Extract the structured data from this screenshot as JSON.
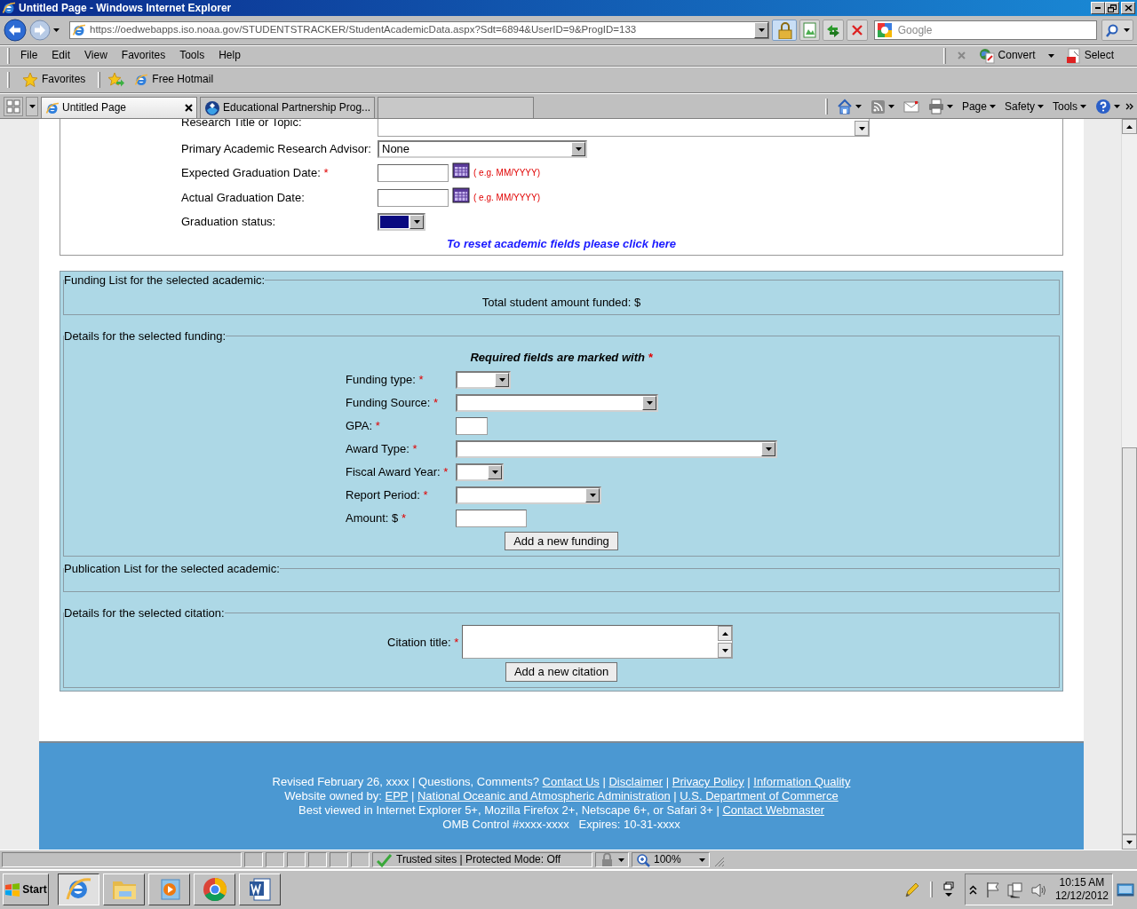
{
  "window": {
    "title": "Untitled Page - Windows Internet Explorer"
  },
  "address_bar": {
    "url": "https://oedwebapps.iso.noaa.gov/STUDENTSTRACKER/StudentAcademicData.aspx?Sdt=6894&UserID=9&ProgID=133",
    "search_placeholder": "Google"
  },
  "menu": [
    "File",
    "Edit",
    "View",
    "Favorites",
    "Tools",
    "Help"
  ],
  "pdf_toolbar": {
    "convert": "Convert",
    "select": "Select"
  },
  "favorites_bar": {
    "favorites": "Favorites",
    "links": [
      "Free Hotmail"
    ]
  },
  "tabs": [
    {
      "label": "Untitled Page",
      "selected": true
    },
    {
      "label": "Educational Partnership Prog...",
      "selected": false
    }
  ],
  "command_bar": [
    "Page",
    "Safety",
    "Tools"
  ],
  "academic": {
    "fields": [
      {
        "label": "Research Title or Topic:",
        "kind": "textarea"
      },
      {
        "label": "Primary Academic Research Advisor:",
        "kind": "select",
        "value": "None"
      },
      {
        "label": "Expected Graduation Date:",
        "mark": "*",
        "kind": "date",
        "hint": "( e.g. MM/YYYY)"
      },
      {
        "label": "Actual Graduation Date:",
        "kind": "date",
        "hint": "( e.g. MM/YYYY)"
      },
      {
        "label": "Graduation status:",
        "kind": "select",
        "focused": true
      }
    ],
    "reset_link": "To reset academic fields please click here"
  },
  "funding_list": {
    "legend": "Funding List for the selected academic:",
    "total": "Total student amount funded: $"
  },
  "funding_details": {
    "legend": "Details for the selected funding:",
    "note": "Required fields are marked with",
    "note_mark": "*",
    "fields": [
      {
        "label": "Funding type:",
        "mark": "*",
        "kind": "select"
      },
      {
        "label": "Funding Source:",
        "mark": "*",
        "kind": "select"
      },
      {
        "label": "GPA:",
        "mark": "*",
        "kind": "text"
      },
      {
        "label": "Award Type:",
        "mark": "*",
        "kind": "select"
      },
      {
        "label": "Fiscal Award Year:",
        "mark": "*",
        "kind": "select"
      },
      {
        "label": "Report Period:",
        "mark": "*",
        "kind": "select"
      },
      {
        "label": "Amount: $",
        "mark": "*",
        "kind": "text"
      }
    ],
    "button": "Add a new funding"
  },
  "publication_list": {
    "legend": "Publication List for the selected academic:"
  },
  "citation_details": {
    "legend": "Details for the selected citation:",
    "field": {
      "label": "Citation title:",
      "mark": "*"
    },
    "button": "Add a new citation"
  },
  "footer": {
    "lines": [
      [
        {
          "text": "Revised February 26, xxxx | Questions, Comments? "
        },
        {
          "text": "Contact Us",
          "link": true
        },
        {
          "text": " | "
        },
        {
          "text": "Disclaimer",
          "link": true
        },
        {
          "text": " | "
        },
        {
          "text": "Privacy Policy",
          "link": true
        },
        {
          "text": " | "
        },
        {
          "text": "Information Quality",
          "link": true
        }
      ],
      [
        {
          "text": "Website owned by: "
        },
        {
          "text": "EPP",
          "link": true
        },
        {
          "text": " | "
        },
        {
          "text": "National Oceanic and Atmospheric Administration",
          "link": true
        },
        {
          "text": " | "
        },
        {
          "text": "U.S. Department of Commerce",
          "link": true
        }
      ],
      [
        {
          "text": "Best viewed in Internet Explorer 5+, Mozilla Firefox 2+, Netscape 6+, or Safari 3+ | "
        },
        {
          "text": "Contact Webmaster",
          "link": true
        }
      ],
      [
        {
          "text": "OMB Control #xxxx-xxxx   Expires: 10-31-xxxx"
        }
      ]
    ]
  },
  "status_bar": {
    "zone": "Trusted sites | Protected Mode: Off",
    "zoom": "100%"
  },
  "taskbar": {
    "start": "Start",
    "apps": [
      {
        "kind": "browser",
        "active": true
      },
      {
        "kind": "folder",
        "active": false
      },
      {
        "kind": "media",
        "active": false
      },
      {
        "kind": "chrome",
        "active": false
      },
      {
        "kind": "word",
        "active": false
      }
    ],
    "time": "10:15 AM",
    "date": "12/12/2012"
  }
}
